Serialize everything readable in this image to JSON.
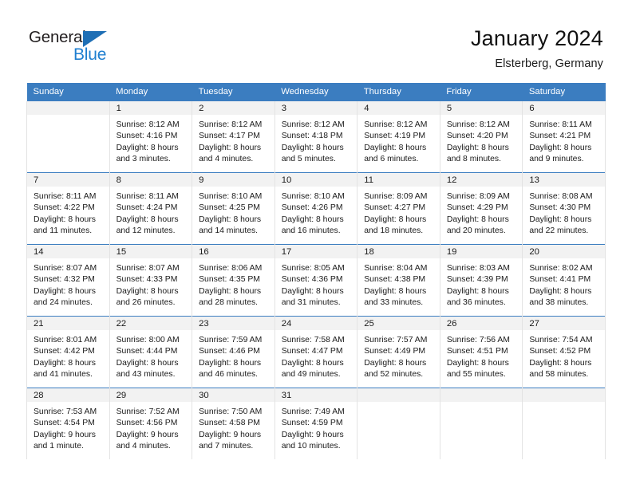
{
  "brand": {
    "name_part1": "General",
    "name_part2": "Blue",
    "accent_color": "#1f7fd0",
    "triangle_color": "#1f6fb5"
  },
  "header": {
    "title": "January 2024",
    "subtitle": "Elsterberg, Germany"
  },
  "theme": {
    "header_row_bg": "#3b7dc0",
    "daynum_band_bg": "#f2f2f2",
    "grid_line": "#e3e3e3",
    "week_separator": "#3b7dc0"
  },
  "weekday_headers": [
    "Sunday",
    "Monday",
    "Tuesday",
    "Wednesday",
    "Thursday",
    "Friday",
    "Saturday"
  ],
  "weeks": [
    {
      "days": [
        {
          "date": "",
          "sunrise": "",
          "sunset": "",
          "daylight_line1": "",
          "daylight_line2": "",
          "empty": true
        },
        {
          "date": "1",
          "sunrise": "Sunrise: 8:12 AM",
          "sunset": "Sunset: 4:16 PM",
          "daylight_line1": "Daylight: 8 hours",
          "daylight_line2": "and 3 minutes.",
          "empty": false
        },
        {
          "date": "2",
          "sunrise": "Sunrise: 8:12 AM",
          "sunset": "Sunset: 4:17 PM",
          "daylight_line1": "Daylight: 8 hours",
          "daylight_line2": "and 4 minutes.",
          "empty": false
        },
        {
          "date": "3",
          "sunrise": "Sunrise: 8:12 AM",
          "sunset": "Sunset: 4:18 PM",
          "daylight_line1": "Daylight: 8 hours",
          "daylight_line2": "and 5 minutes.",
          "empty": false
        },
        {
          "date": "4",
          "sunrise": "Sunrise: 8:12 AM",
          "sunset": "Sunset: 4:19 PM",
          "daylight_line1": "Daylight: 8 hours",
          "daylight_line2": "and 6 minutes.",
          "empty": false
        },
        {
          "date": "5",
          "sunrise": "Sunrise: 8:12 AM",
          "sunset": "Sunset: 4:20 PM",
          "daylight_line1": "Daylight: 8 hours",
          "daylight_line2": "and 8 minutes.",
          "empty": false
        },
        {
          "date": "6",
          "sunrise": "Sunrise: 8:11 AM",
          "sunset": "Sunset: 4:21 PM",
          "daylight_line1": "Daylight: 8 hours",
          "daylight_line2": "and 9 minutes.",
          "empty": false
        }
      ]
    },
    {
      "days": [
        {
          "date": "7",
          "sunrise": "Sunrise: 8:11 AM",
          "sunset": "Sunset: 4:22 PM",
          "daylight_line1": "Daylight: 8 hours",
          "daylight_line2": "and 11 minutes.",
          "empty": false
        },
        {
          "date": "8",
          "sunrise": "Sunrise: 8:11 AM",
          "sunset": "Sunset: 4:24 PM",
          "daylight_line1": "Daylight: 8 hours",
          "daylight_line2": "and 12 minutes.",
          "empty": false
        },
        {
          "date": "9",
          "sunrise": "Sunrise: 8:10 AM",
          "sunset": "Sunset: 4:25 PM",
          "daylight_line1": "Daylight: 8 hours",
          "daylight_line2": "and 14 minutes.",
          "empty": false
        },
        {
          "date": "10",
          "sunrise": "Sunrise: 8:10 AM",
          "sunset": "Sunset: 4:26 PM",
          "daylight_line1": "Daylight: 8 hours",
          "daylight_line2": "and 16 minutes.",
          "empty": false
        },
        {
          "date": "11",
          "sunrise": "Sunrise: 8:09 AM",
          "sunset": "Sunset: 4:27 PM",
          "daylight_line1": "Daylight: 8 hours",
          "daylight_line2": "and 18 minutes.",
          "empty": false
        },
        {
          "date": "12",
          "sunrise": "Sunrise: 8:09 AM",
          "sunset": "Sunset: 4:29 PM",
          "daylight_line1": "Daylight: 8 hours",
          "daylight_line2": "and 20 minutes.",
          "empty": false
        },
        {
          "date": "13",
          "sunrise": "Sunrise: 8:08 AM",
          "sunset": "Sunset: 4:30 PM",
          "daylight_line1": "Daylight: 8 hours",
          "daylight_line2": "and 22 minutes.",
          "empty": false
        }
      ]
    },
    {
      "days": [
        {
          "date": "14",
          "sunrise": "Sunrise: 8:07 AM",
          "sunset": "Sunset: 4:32 PM",
          "daylight_line1": "Daylight: 8 hours",
          "daylight_line2": "and 24 minutes.",
          "empty": false
        },
        {
          "date": "15",
          "sunrise": "Sunrise: 8:07 AM",
          "sunset": "Sunset: 4:33 PM",
          "daylight_line1": "Daylight: 8 hours",
          "daylight_line2": "and 26 minutes.",
          "empty": false
        },
        {
          "date": "16",
          "sunrise": "Sunrise: 8:06 AM",
          "sunset": "Sunset: 4:35 PM",
          "daylight_line1": "Daylight: 8 hours",
          "daylight_line2": "and 28 minutes.",
          "empty": false
        },
        {
          "date": "17",
          "sunrise": "Sunrise: 8:05 AM",
          "sunset": "Sunset: 4:36 PM",
          "daylight_line1": "Daylight: 8 hours",
          "daylight_line2": "and 31 minutes.",
          "empty": false
        },
        {
          "date": "18",
          "sunrise": "Sunrise: 8:04 AM",
          "sunset": "Sunset: 4:38 PM",
          "daylight_line1": "Daylight: 8 hours",
          "daylight_line2": "and 33 minutes.",
          "empty": false
        },
        {
          "date": "19",
          "sunrise": "Sunrise: 8:03 AM",
          "sunset": "Sunset: 4:39 PM",
          "daylight_line1": "Daylight: 8 hours",
          "daylight_line2": "and 36 minutes.",
          "empty": false
        },
        {
          "date": "20",
          "sunrise": "Sunrise: 8:02 AM",
          "sunset": "Sunset: 4:41 PM",
          "daylight_line1": "Daylight: 8 hours",
          "daylight_line2": "and 38 minutes.",
          "empty": false
        }
      ]
    },
    {
      "days": [
        {
          "date": "21",
          "sunrise": "Sunrise: 8:01 AM",
          "sunset": "Sunset: 4:42 PM",
          "daylight_line1": "Daylight: 8 hours",
          "daylight_line2": "and 41 minutes.",
          "empty": false
        },
        {
          "date": "22",
          "sunrise": "Sunrise: 8:00 AM",
          "sunset": "Sunset: 4:44 PM",
          "daylight_line1": "Daylight: 8 hours",
          "daylight_line2": "and 43 minutes.",
          "empty": false
        },
        {
          "date": "23",
          "sunrise": "Sunrise: 7:59 AM",
          "sunset": "Sunset: 4:46 PM",
          "daylight_line1": "Daylight: 8 hours",
          "daylight_line2": "and 46 minutes.",
          "empty": false
        },
        {
          "date": "24",
          "sunrise": "Sunrise: 7:58 AM",
          "sunset": "Sunset: 4:47 PM",
          "daylight_line1": "Daylight: 8 hours",
          "daylight_line2": "and 49 minutes.",
          "empty": false
        },
        {
          "date": "25",
          "sunrise": "Sunrise: 7:57 AM",
          "sunset": "Sunset: 4:49 PM",
          "daylight_line1": "Daylight: 8 hours",
          "daylight_line2": "and 52 minutes.",
          "empty": false
        },
        {
          "date": "26",
          "sunrise": "Sunrise: 7:56 AM",
          "sunset": "Sunset: 4:51 PM",
          "daylight_line1": "Daylight: 8 hours",
          "daylight_line2": "and 55 minutes.",
          "empty": false
        },
        {
          "date": "27",
          "sunrise": "Sunrise: 7:54 AM",
          "sunset": "Sunset: 4:52 PM",
          "daylight_line1": "Daylight: 8 hours",
          "daylight_line2": "and 58 minutes.",
          "empty": false
        }
      ]
    },
    {
      "days": [
        {
          "date": "28",
          "sunrise": "Sunrise: 7:53 AM",
          "sunset": "Sunset: 4:54 PM",
          "daylight_line1": "Daylight: 9 hours",
          "daylight_line2": "and 1 minute.",
          "empty": false
        },
        {
          "date": "29",
          "sunrise": "Sunrise: 7:52 AM",
          "sunset": "Sunset: 4:56 PM",
          "daylight_line1": "Daylight: 9 hours",
          "daylight_line2": "and 4 minutes.",
          "empty": false
        },
        {
          "date": "30",
          "sunrise": "Sunrise: 7:50 AM",
          "sunset": "Sunset: 4:58 PM",
          "daylight_line1": "Daylight: 9 hours",
          "daylight_line2": "and 7 minutes.",
          "empty": false
        },
        {
          "date": "31",
          "sunrise": "Sunrise: 7:49 AM",
          "sunset": "Sunset: 4:59 PM",
          "daylight_line1": "Daylight: 9 hours",
          "daylight_line2": "and 10 minutes.",
          "empty": false
        },
        {
          "date": "",
          "sunrise": "",
          "sunset": "",
          "daylight_line1": "",
          "daylight_line2": "",
          "empty": true
        },
        {
          "date": "",
          "sunrise": "",
          "sunset": "",
          "daylight_line1": "",
          "daylight_line2": "",
          "empty": true
        },
        {
          "date": "",
          "sunrise": "",
          "sunset": "",
          "daylight_line1": "",
          "daylight_line2": "",
          "empty": true
        }
      ]
    }
  ]
}
